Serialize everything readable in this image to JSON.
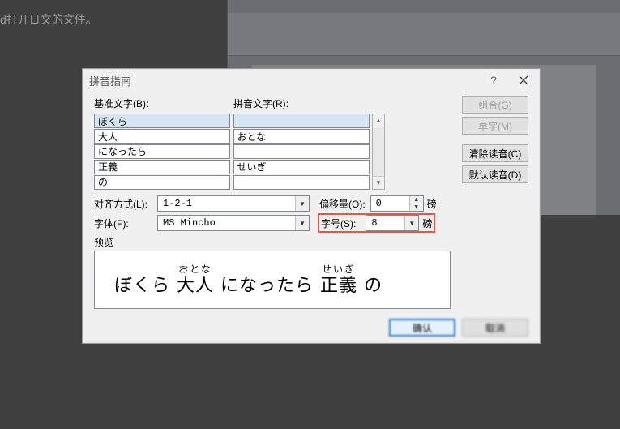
{
  "bg": {
    "text": "d打开日文的文件。"
  },
  "dialog": {
    "title": "拼音指南",
    "labels": {
      "base": "基准文字(B):",
      "ruby": "拼音文字(R):",
      "align": "对齐方式(L):",
      "font": "字体(F):",
      "offset": "偏移量(O):",
      "size": "字号(S):",
      "pt1": "磅",
      "pt2": "磅",
      "preview": "预览"
    },
    "rows": [
      {
        "base": "ぼくら",
        "ruby": ""
      },
      {
        "base": "大人",
        "ruby": "おとな"
      },
      {
        "base": "になったら",
        "ruby": ""
      },
      {
        "base": "正義",
        "ruby": "せいぎ"
      },
      {
        "base": "の",
        "ruby": ""
      }
    ],
    "align_value": "1-2-1",
    "font_value": "MS Mincho",
    "offset_value": "0",
    "size_value": "8",
    "buttons": {
      "group": "组合(G)",
      "single": "单字(M)",
      "clear": "清除读音(C)",
      "default": "默认读音(D)",
      "ok": "确认",
      "cancel": "取消"
    },
    "preview_groups": [
      {
        "ruby": "",
        "base": "ぼくら"
      },
      {
        "ruby": "おとな",
        "base": "大人"
      },
      {
        "ruby": "",
        "base": "になったら"
      },
      {
        "ruby": "せいぎ",
        "base": "正義"
      },
      {
        "ruby": "",
        "base": "の"
      }
    ]
  }
}
